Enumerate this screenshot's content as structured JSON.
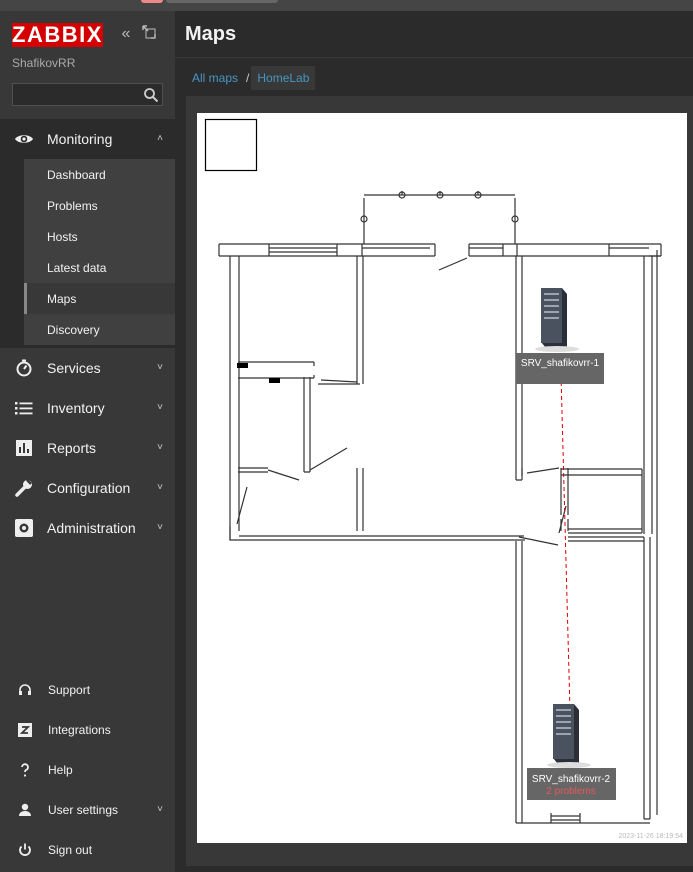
{
  "app": {
    "logo": "ZABBIX",
    "username": "ShafikovRR"
  },
  "search": {
    "placeholder": "",
    "value": ""
  },
  "sidebar": {
    "main_menu": [
      {
        "label": "Monitoring",
        "icon": "eye-icon",
        "expanded": true
      },
      {
        "label": "Services",
        "icon": "stopwatch-icon"
      },
      {
        "label": "Inventory",
        "icon": "list-icon"
      },
      {
        "label": "Reports",
        "icon": "bar-chart-icon"
      },
      {
        "label": "Configuration",
        "icon": "wrench-icon"
      },
      {
        "label": "Administration",
        "icon": "gear-icon"
      }
    ],
    "monitoring_submenu": [
      {
        "label": "Dashboard"
      },
      {
        "label": "Problems"
      },
      {
        "label": "Hosts"
      },
      {
        "label": "Latest data"
      },
      {
        "label": "Maps",
        "active": true
      },
      {
        "label": "Discovery"
      }
    ],
    "bottom_menu": [
      {
        "label": "Support",
        "icon": "headset-icon"
      },
      {
        "label": "Integrations",
        "icon": "zabbix-z-icon"
      },
      {
        "label": "Help",
        "icon": "question-icon"
      },
      {
        "label": "User settings",
        "icon": "user-icon"
      },
      {
        "label": "Sign out",
        "icon": "power-icon"
      }
    ]
  },
  "page": {
    "title": "Maps"
  },
  "breadcrumb": {
    "root": "All maps",
    "separator": "/",
    "current": "HomeLab"
  },
  "map": {
    "timestamp": "2023-11-26 18:19:54",
    "hosts": [
      {
        "name": "SRV_shafikovrr-1",
        "status": ""
      },
      {
        "name": "SRV_shafikovrr-2",
        "status": "2 problems"
      }
    ]
  },
  "colors": {
    "brand": "#d40000",
    "link": "#4796c4",
    "problem": "#e45959",
    "ok": "#59db8f"
  }
}
